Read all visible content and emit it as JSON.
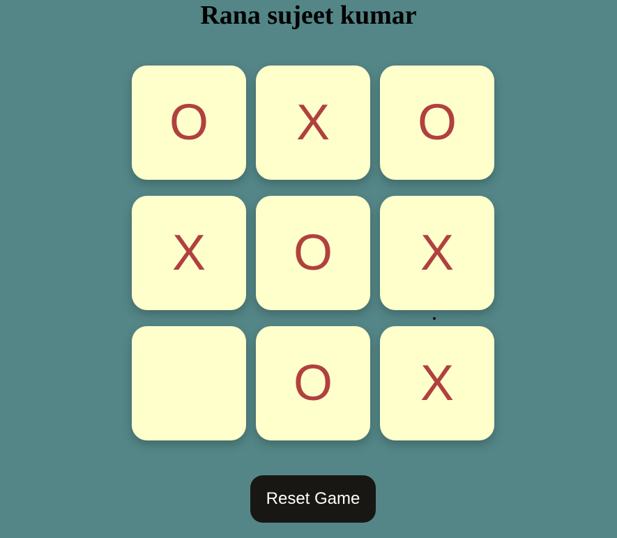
{
  "title": "Rana sujeet kumar",
  "board": {
    "cells": [
      "O",
      "X",
      "O",
      "X",
      "O",
      "X",
      "",
      "O",
      "X"
    ]
  },
  "reset_label": "Reset Game",
  "colors": {
    "background": "#548687",
    "cell": "#ffffcc",
    "mark": "#b0413e",
    "button": "#191713",
    "button_text": "#ffffff"
  }
}
